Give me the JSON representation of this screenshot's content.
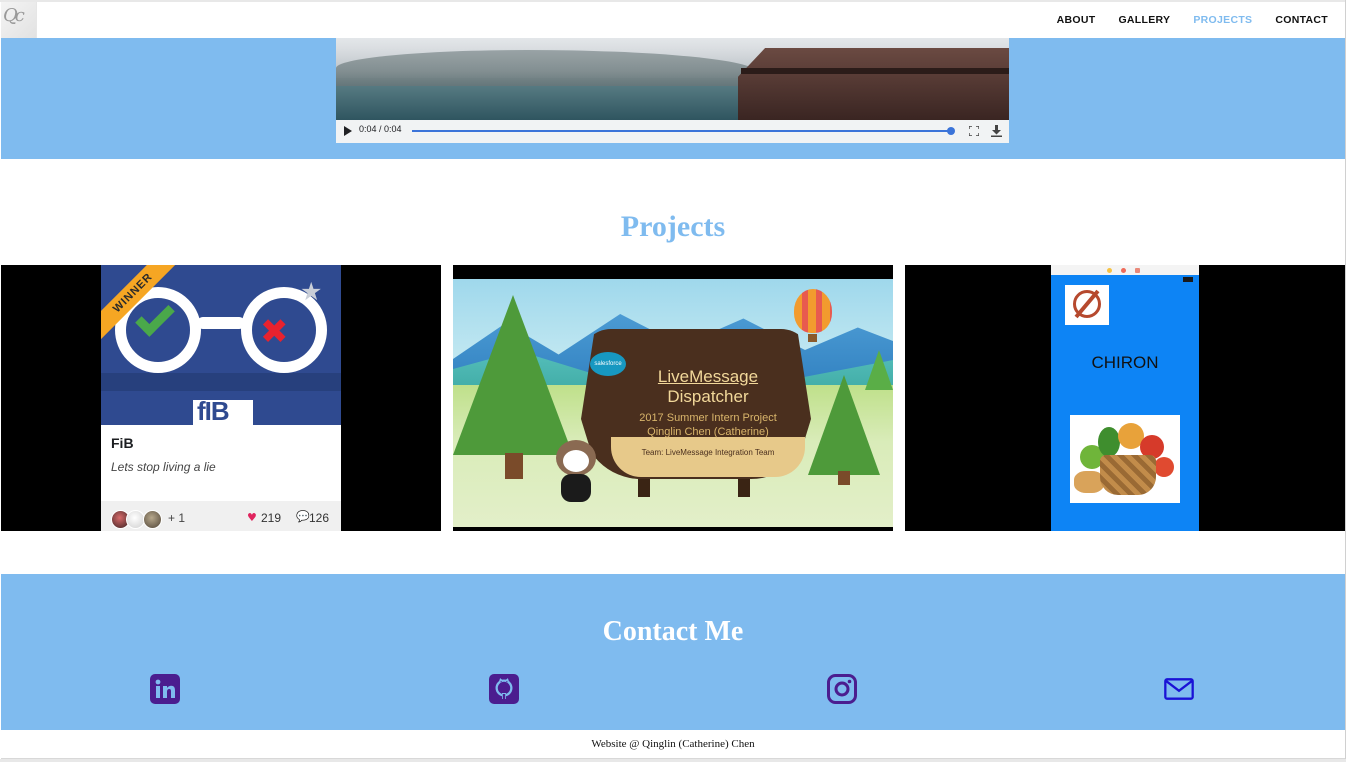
{
  "nav": {
    "logo_text": "Qc",
    "links": [
      {
        "label": "ABOUT",
        "active": false
      },
      {
        "label": "GALLERY",
        "active": false
      },
      {
        "label": "PROJECTS",
        "active": true
      },
      {
        "label": "CONTACT",
        "active": false
      }
    ]
  },
  "video": {
    "time": "0:04 / 0:04",
    "progress": 1.0,
    "icons": [
      "play-icon",
      "fullscreen-icon",
      "download-icon"
    ]
  },
  "projects": {
    "title": "Projects",
    "cards": [
      {
        "name": "FiB",
        "tagline": "Lets stop living a lie",
        "ribbon": "WINNER",
        "logo_text": "fIB",
        "more_contributors": "+ 1",
        "likes": "219",
        "comments": "126"
      },
      {
        "badge": "salesforce",
        "title_line1": "LiveMessage",
        "title_line2": "Dispatcher",
        "subtitle_line1": "2017 Summer Intern Project",
        "subtitle_line2": "Qinglin Chen (Catherine)",
        "team": "Team: LiveMessage Integration Team"
      },
      {
        "name": "CHIRON"
      }
    ]
  },
  "contact": {
    "title": "Contact Me",
    "icons": [
      "linkedin-icon",
      "github-icon",
      "instagram-icon",
      "mail-icon"
    ],
    "icon_color": "#4b1d8f",
    "mail_color": "#1a12d6"
  },
  "footer": {
    "text": "Website @ Qinglin (Catherine) Chen"
  },
  "colors": {
    "accent": "#7fbbef",
    "nav_active": "#7fbbef",
    "title_projects": "#7fbbef"
  }
}
